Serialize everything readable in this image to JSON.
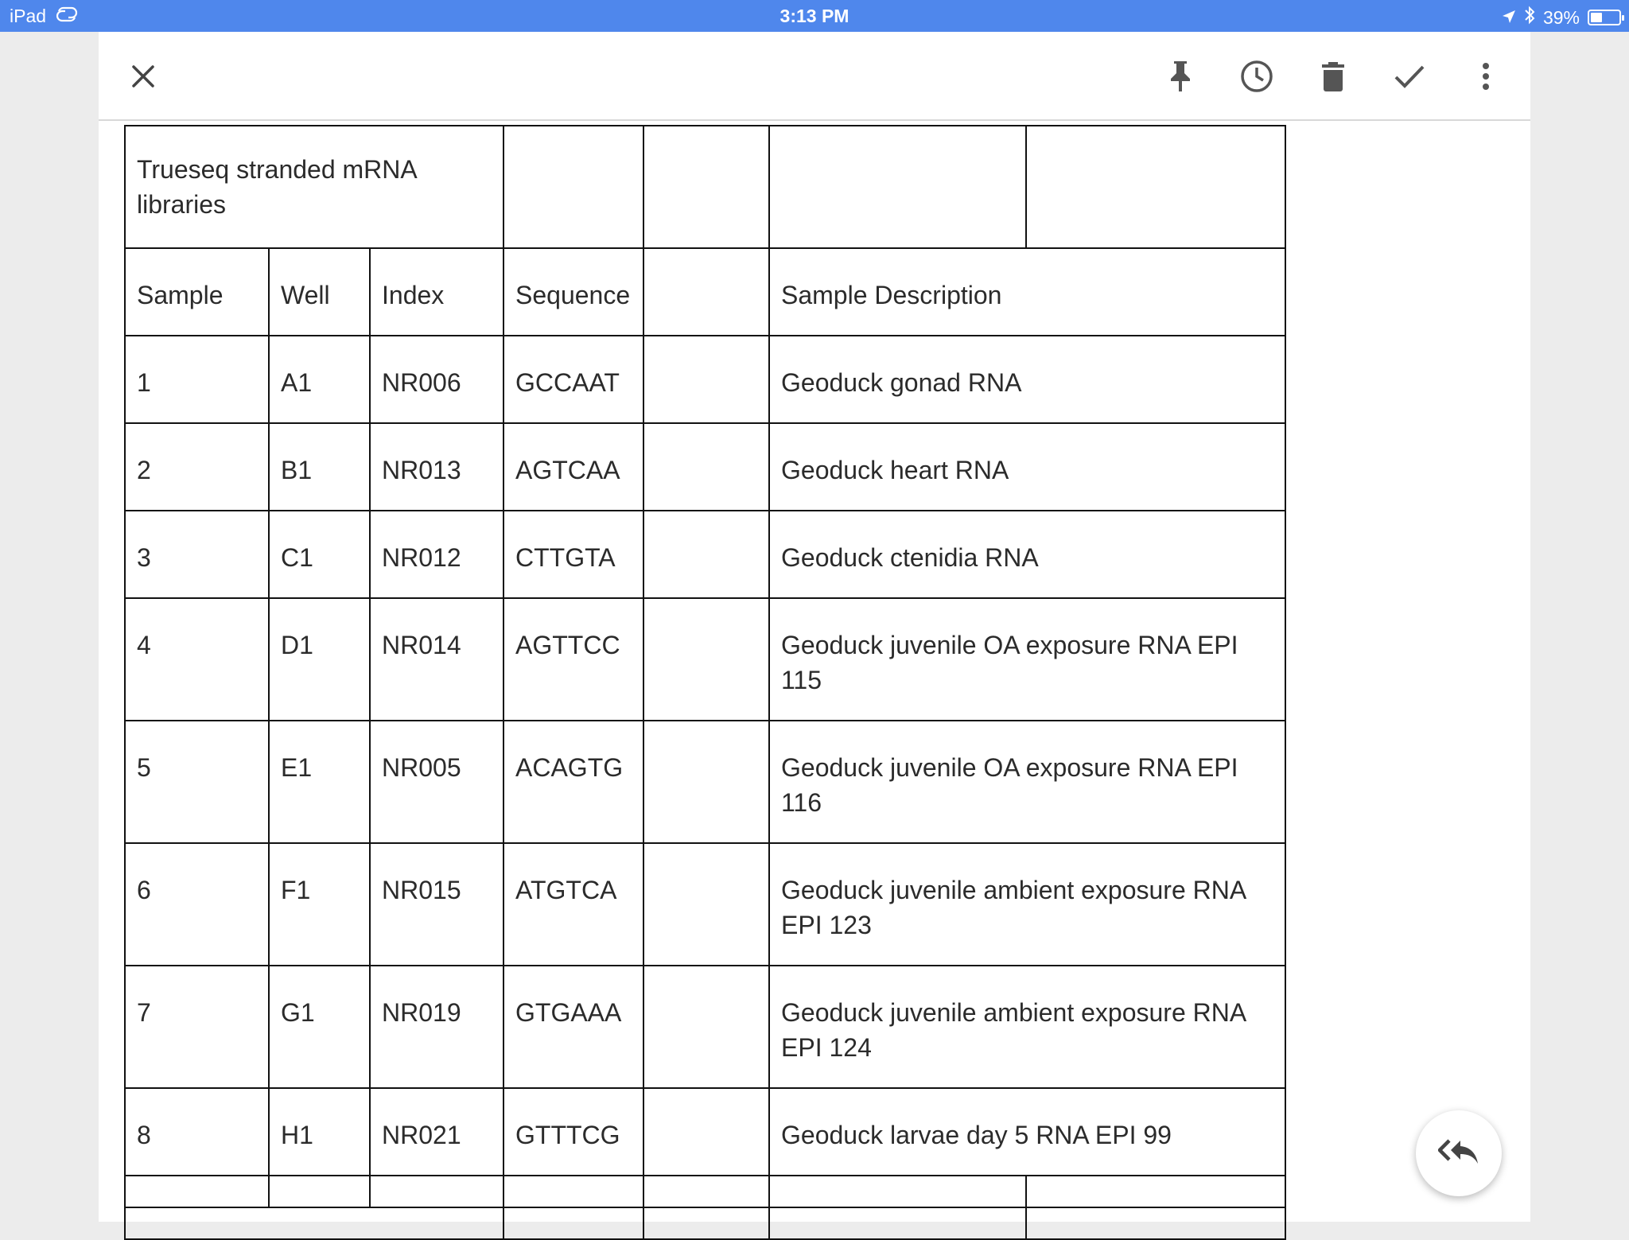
{
  "status_bar": {
    "device": "iPad",
    "time": "3:13 PM",
    "battery": "39%"
  },
  "toolbar": {
    "icons": [
      "close-icon",
      "pin-icon",
      "reminder-clock-icon",
      "delete-icon",
      "done-check-icon",
      "more-vert-icon"
    ]
  },
  "table": {
    "title": "Trueseq stranded mRNA libraries",
    "headers": {
      "sample": "Sample",
      "well": "Well",
      "index": "Index",
      "sequence": "Sequence",
      "blank": "",
      "description": "Sample Description"
    },
    "rows": [
      {
        "sample": "1",
        "well": "A1",
        "index": "NR006",
        "sequence": "GCCAAT",
        "description": "Geoduck gonad RNA"
      },
      {
        "sample": "2",
        "well": "B1",
        "index": "NR013",
        "sequence": "AGTCAA",
        "description": "Geoduck heart RNA"
      },
      {
        "sample": "3",
        "well": "C1",
        "index": "NR012",
        "sequence": "CTTGTA",
        "description": "Geoduck ctenidia RNA"
      },
      {
        "sample": "4",
        "well": "D1",
        "index": "NR014",
        "sequence": "AGTTCC",
        "description": "Geoduck juvenile OA exposure RNA EPI 115"
      },
      {
        "sample": "5",
        "well": "E1",
        "index": "NR005",
        "sequence": "ACAGTG",
        "description": "Geoduck juvenile OA exposure RNA EPI 116"
      },
      {
        "sample": "6",
        "well": "F1",
        "index": "NR015",
        "sequence": "ATGTCA",
        "description": "Geoduck juvenile ambient exposure RNA EPI 123"
      },
      {
        "sample": "7",
        "well": "G1",
        "index": "NR019",
        "sequence": "GTGAAA",
        "description": "Geoduck juvenile ambient exposure RNA EPI 124"
      },
      {
        "sample": "8",
        "well": "H1",
        "index": "NR021",
        "sequence": "GTTTCG",
        "description": "Geoduck larvae day 5 RNA EPI 99"
      }
    ]
  },
  "fab": {
    "icon": "reply-all-icon"
  }
}
